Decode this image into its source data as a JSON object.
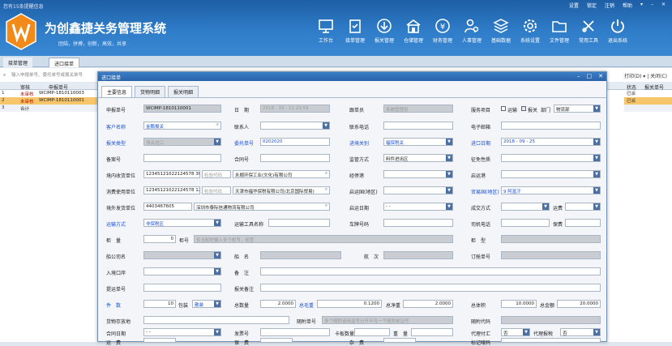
{
  "header": {
    "notice": "您有15条提醒信息",
    "title": "为创鑫捷关务管理系统",
    "slogan": "团结，拼搏，创新，高效，共享",
    "window": [
      "设置",
      "锁定",
      "注销",
      "帮助",
      "▾",
      "–",
      "✕"
    ],
    "nav": [
      "工作台",
      "接单管理",
      "报关管理",
      "仓储管理",
      "财务管理",
      "人事管理",
      "基础数据",
      "系统设置",
      "文件管理",
      "常用工具",
      "退出系统"
    ]
  },
  "tabs": [
    "接单管理",
    "进口接单"
  ],
  "list": {
    "search_placeholder": "输入申报单号、委托单号或报关单号",
    "right_toolbar": "打印(D) ▾ | 关闭(C)",
    "headers": [
      "审核",
      "申报单号"
    ],
    "right_headers": [
      "状态",
      "报关单号"
    ],
    "rows": [
      {
        "num": "1",
        "state": "未审核",
        "no": "WCIMP-1810110003"
      },
      {
        "num": "2",
        "state": "未审核",
        "no": "WCIMP-1810110001"
      },
      {
        "num": "3",
        "state": "合计",
        "no": ""
      }
    ],
    "right_rows": [
      "已派",
      "已派",
      ""
    ]
  },
  "dialog": {
    "title": "进口接单",
    "tabs": [
      "主要信息",
      "货物明细",
      "报关明细"
    ],
    "labels": {
      "sbdh": "申报单号",
      "rq": "日　期",
      "gdy": "跟单员",
      "fwxm": "服务项目",
      "ys": "运输",
      "bg": "报关",
      "bm": "部门",
      "khmc": "客户名称",
      "lxr": "联系人",
      "lxdh": "联系电话",
      "dzyx": "电子邮箱",
      "bglx": "报关类型",
      "wtdh": "委托单号",
      "jjgg": "进境关别",
      "jkrq": "进口日期",
      "bah": "备案号",
      "hth": "合同号",
      "jgfs": "监管方式",
      "zmxz": "征免性质",
      "jnsh": "境内收货单位",
      "jyd": "经停港",
      "qyg": "启运港",
      "xfsy": "消费使用单位",
      "qyg2": "启运国(地区)",
      "myg": "贸易国(地区)",
      "kzfh": "境外发货单位",
      "qyrq": "启运日期",
      "cjfs": "成交方式",
      "yf": "运费",
      "ysfs": "运输方式",
      "ysgj": "运输工具名称",
      "chh": "车牌号码",
      "sjdh": "司机电话",
      "bxf": "保费",
      "gh": "柜　量",
      "gxh": "柜号",
      "gx": "柜　型",
      "cgs": "船公司名",
      "cm": "船　名",
      "hc": "航　次",
      "dcdh": "订舱单号",
      "rjkc": "入境口岸",
      "bz": "备　注",
      "tydh": "提运单号",
      "bgbz": "报关备注",
      "js": "件　数",
      "bz2": "包装",
      "zsl": "总数量",
      "zmz": "总毛重",
      "zjz": "总净重",
      "ztj": "总体积",
      "zje": "总金额",
      "hwcf": "货物存放地",
      "gljh": "随附单号",
      "gldm": "随附代码",
      "htrq": "合同日期",
      "fph": "发票号",
      "kbsl": "卡板数量",
      "zl": "重　量",
      "dlfz": "代理付汇",
      "dlbs": "代理报税",
      "yfl": "运　费",
      "bfl": "保　费",
      "zf": "杂　费",
      "bjdh": "标记唛码"
    },
    "values": {
      "sbdh": "WCIMP-1810110001",
      "rq": "2018 - 10 - 11  23:59",
      "gdy": "系统管理员",
      "bm": "物流部",
      "khmc": "金鹏报关",
      "bglx": "清关进口",
      "wtdh": "0202020",
      "jjgg": "福保税关",
      "jkrq": "2018 - 09 - 25",
      "jgfs": "料件进出区",
      "jnsh_code": "12345121022124578 3026941130",
      "jnsh_ph": "检验代码",
      "jnsh_name": "永顺环保工业(文化)有限公司",
      "xfsy_code": "12345121022124578 1207660028",
      "xfsy_ph": "检验代码",
      "xfsy_name": "天津市福华保税有限公司(北京国际贸易)",
      "myg": "9 阿富汗",
      "kzfh_code": "4403467605",
      "kzfh_name": "深圳市泰际信通物流有限公司",
      "qyrq": "-  -",
      "ysfs": "非保税区",
      "gh": "0",
      "gxh_ph": "仅当柜时输入多个柜号，柜型",
      "js": "10",
      "bz2": "散装",
      "zsl": "2.0000",
      "zmz": "0.1200",
      "zjz": "2.0000",
      "ztj": "10.0000",
      "zje": "20.0000",
      "gljh_ph": "多个随附请用逗号分开不可一个随附单证号",
      "htrq": "-  -",
      "dlfz": "否",
      "dlbs": "否"
    }
  }
}
